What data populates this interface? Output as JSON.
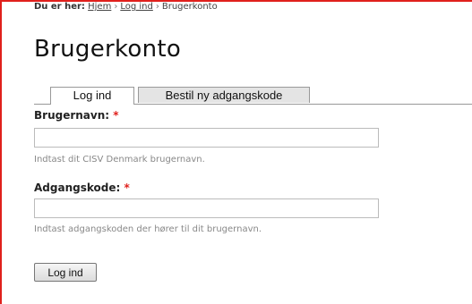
{
  "breadcrumb": {
    "prefix": "Du er her:",
    "items": [
      "Hjem",
      "Log ind",
      "Brugerkonto"
    ],
    "separator": "›"
  },
  "page_title": "Brugerkonto",
  "tabs": [
    {
      "label": "Log ind",
      "active": true
    },
    {
      "label": "Bestil ny adgangskode",
      "active": false
    }
  ],
  "form": {
    "username": {
      "label": "Brugernavn:",
      "required_mark": "*",
      "value": "",
      "help": "Indtast dit CISV Denmark brugernavn."
    },
    "password": {
      "label": "Adgangskode:",
      "required_mark": "*",
      "value": "",
      "help": "Indtast adgangskoden der hører til dit brugernavn."
    },
    "submit_label": "Log ind"
  },
  "colors": {
    "accent": "#e0201c",
    "tab_inactive_bg": "#e4e4e4"
  }
}
